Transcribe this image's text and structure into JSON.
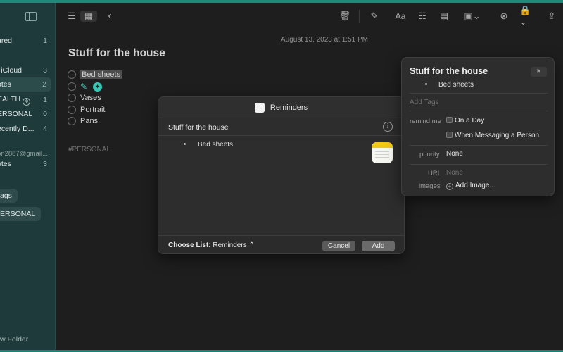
{
  "sidebar": {
    "items": [
      {
        "label": "ared",
        "count": "1"
      },
      {
        "label": "l iCloud",
        "count": "3"
      },
      {
        "label": "otes",
        "count": "2"
      },
      {
        "label": "EALTH",
        "count": "1"
      },
      {
        "label": "ERSONAL",
        "count": "0"
      },
      {
        "label": "ecently D...",
        "count": "4"
      },
      {
        "label": "on2887@gmail..."
      },
      {
        "label": "otes",
        "count": "3"
      }
    ],
    "tags": [
      "ags",
      "ERSONAL"
    ],
    "new_folder": "w Folder"
  },
  "note": {
    "date": "August 13, 2023 at 1:51 PM",
    "title": "Stuff for the house",
    "items": [
      "Bed sheets",
      "",
      "Vases",
      "Portrait",
      "Pans"
    ],
    "hashtag": "#PERSONAL"
  },
  "dialog": {
    "title": "Reminders",
    "reminder_name": "Stuff for the house",
    "bullet": "Bed sheets",
    "choose_label": "Choose List:",
    "list_value": "Reminders ⌃",
    "cancel": "Cancel",
    "add": "Add"
  },
  "popover": {
    "title": "Stuff for the house",
    "bullet": "Bed sheets",
    "add_tags": "Add Tags",
    "remind_label": "remind me",
    "on_a_day": "On a Day",
    "when_messaging": "When Messaging a Person",
    "priority_label": "priority",
    "priority_value": "None",
    "url_label": "URL",
    "url_value": "None",
    "images_label": "images",
    "add_image": "Add Image..."
  }
}
